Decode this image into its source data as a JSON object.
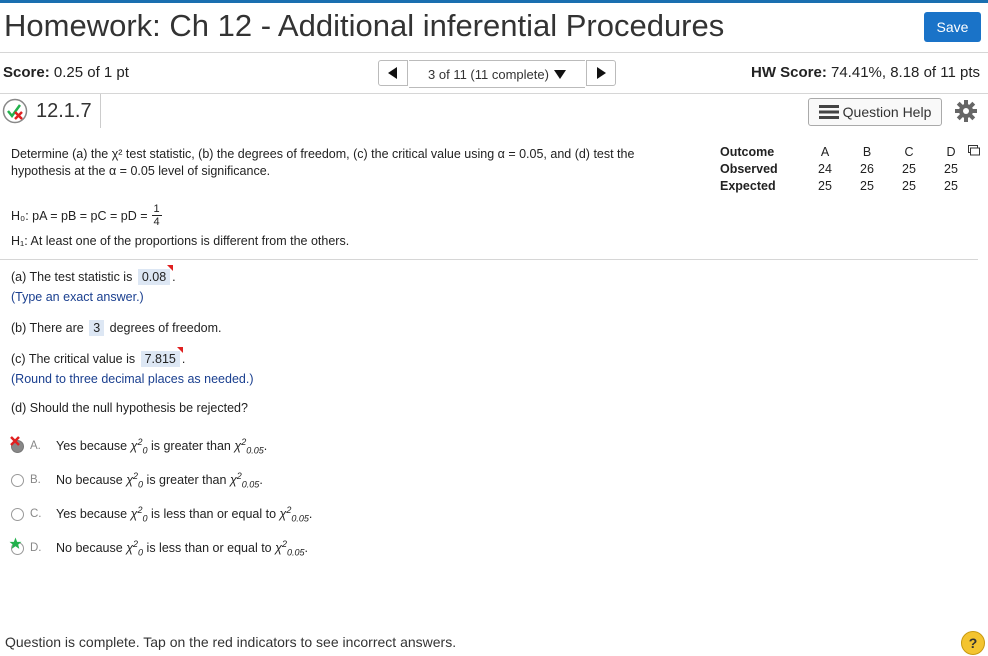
{
  "header": {
    "title": "Homework: Ch 12 - Additional inferential Procedures",
    "save_label": "Save",
    "score_label": "Score:",
    "score_value": "0.25 of 1 pt",
    "nav_label": "3 of 11 (11 complete)",
    "hw_score_label": "HW Score:",
    "hw_score_value": "74.41%, 8.18 of 11 pts"
  },
  "question": {
    "number": "12.1.7",
    "help_label": "Question Help",
    "prompt_line1": "Determine (a) the χ² test statistic, (b) the degrees of freedom, (c) the critical value using α = 0.05, and (d) test the",
    "prompt_line2": "hypothesis at the α = 0.05 level of significance.",
    "h0_text": "H₀: pA = pB = pC = pD =",
    "h0_num": "1",
    "h0_den": "4",
    "h1_text": "H₁: At least one of the proportions is different from the others."
  },
  "table": {
    "row_labels": [
      "Outcome",
      "Observed",
      "Expected"
    ],
    "columns": [
      "A",
      "B",
      "C",
      "D"
    ],
    "observed": [
      "24",
      "26",
      "25",
      "25"
    ],
    "expected": [
      "25",
      "25",
      "25",
      "25"
    ]
  },
  "parts": {
    "a_prefix": "(a) The test statistic is",
    "a_value": "0.08",
    "a_hint": "(Type an exact answer.)",
    "b_prefix": "(b) There are",
    "b_value": "3",
    "b_suffix": "degrees of freedom.",
    "c_prefix": "(c) The critical value is",
    "c_value": "7.815",
    "c_hint": "(Round to three decimal places as needed.)",
    "d_question": "(d) Should the null hypothesis be rejected?"
  },
  "options": [
    {
      "letter": "A.",
      "start": "Yes because",
      "mid": "is greater than"
    },
    {
      "letter": "B.",
      "start": "No because",
      "mid": "is greater than"
    },
    {
      "letter": "C.",
      "start": "Yes because",
      "mid": "is less than or equal to"
    },
    {
      "letter": "D.",
      "start": "No because",
      "mid": "is less than or equal to"
    }
  ],
  "math": {
    "chi": "χ",
    "sup2": "2",
    "sub0": "0",
    "sub005": "0.05"
  },
  "footer": {
    "status": "Question is complete. Tap on the red indicators to see incorrect answers.",
    "help_symbol": "?"
  },
  "colors": {
    "accent": "#1a73c8",
    "incorrect": "#e02020",
    "correct": "#22b14c",
    "answer_bg": "#dde7f4",
    "hint_text": "#1a3f8f"
  }
}
